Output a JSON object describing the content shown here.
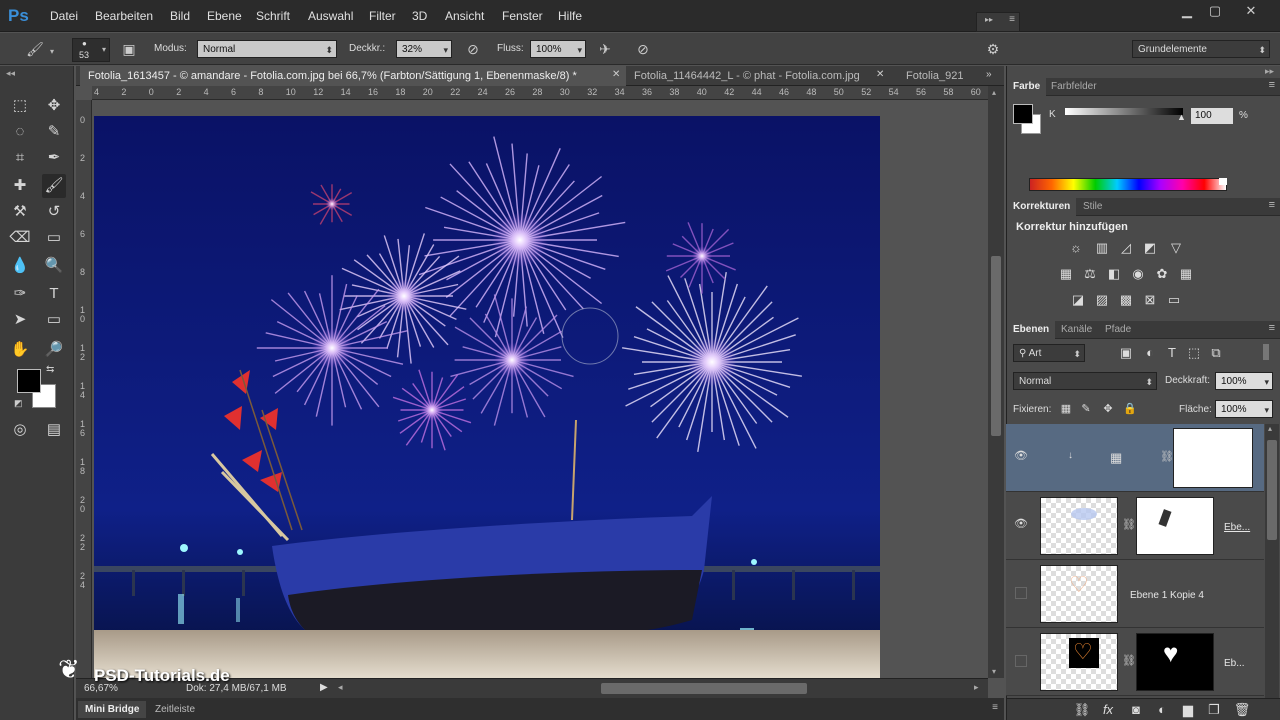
{
  "app": {
    "logo": "Ps"
  },
  "menu": [
    "Datei",
    "Bearbeiten",
    "Bild",
    "Ebene",
    "Schrift",
    "Auswahl",
    "Filter",
    "3D",
    "Ansicht",
    "Fenster",
    "Hilfe"
  ],
  "options": {
    "brush_size": "53",
    "modus_label": "Modus:",
    "modus_value": "Normal",
    "deckkr_label": "Deckkr.:",
    "deckkr_value": "32%",
    "fluss_label": "Fluss:",
    "fluss_value": "100%",
    "workspace": "Grundelemente"
  },
  "tabs": [
    {
      "label": "Fotolia_1613457 - © amandare - Fotolia.com.jpg bei 66,7% (Farbton/Sättigung 1, Ebenenmaske/8) *"
    },
    {
      "label": "Fotolia_11464442_L - © phat - Fotolia.com.jpg"
    },
    {
      "label": "Fotolia_921"
    }
  ],
  "ruler_h": [
    "4",
    "2",
    "0",
    "2",
    "4",
    "6",
    "8",
    "10",
    "12",
    "14",
    "16",
    "18",
    "20",
    "22",
    "24",
    "26",
    "28",
    "30",
    "32",
    "34",
    "36",
    "38",
    "40",
    "42",
    "44",
    "46",
    "48",
    "50",
    "52",
    "54",
    "56",
    "58",
    "60"
  ],
  "ruler_v": [
    "0",
    "2",
    "4",
    "6",
    "8",
    "1\n0",
    "1\n2",
    "1\n4",
    "1\n6",
    "1\n8",
    "2\n0",
    "2\n2",
    "2\n4"
  ],
  "status": {
    "zoom": "66,67%",
    "doc": "Dok: 27,4 MB/67,1 MB"
  },
  "watermark": "PSD-Tutorials.de",
  "bottom_tabs": [
    "Mini Bridge",
    "Zeitleiste"
  ],
  "color_panel": {
    "tabs": [
      "Farbe",
      "Farbfelder"
    ],
    "channel": "K",
    "value": "100",
    "unit": "%"
  },
  "adjustments": {
    "tabs": [
      "Korrekturen",
      "Stile"
    ],
    "title": "Korrektur hinzufügen"
  },
  "layers_panel": {
    "tabs": [
      "Ebenen",
      "Kanäle",
      "Pfade"
    ],
    "filter": "Art",
    "blend": "Normal",
    "opacity_label": "Deckkraft:",
    "opacity_value": "100%",
    "lock_label": "Fixieren:",
    "fill_label": "Fläche:",
    "fill_value": "100%",
    "layers": [
      {
        "name": "",
        "visible": true,
        "selected": true
      },
      {
        "name": "Ebe...",
        "visible": true,
        "selected": false
      },
      {
        "name": "Ebene 1 Kopie 4",
        "visible": false,
        "selected": false
      },
      {
        "name": "Eb...",
        "visible": false,
        "selected": false
      }
    ]
  },
  "colors": {
    "accent": "#3a8fd9",
    "selected_layer": "#576a82",
    "sky": "#0c1a6e"
  }
}
